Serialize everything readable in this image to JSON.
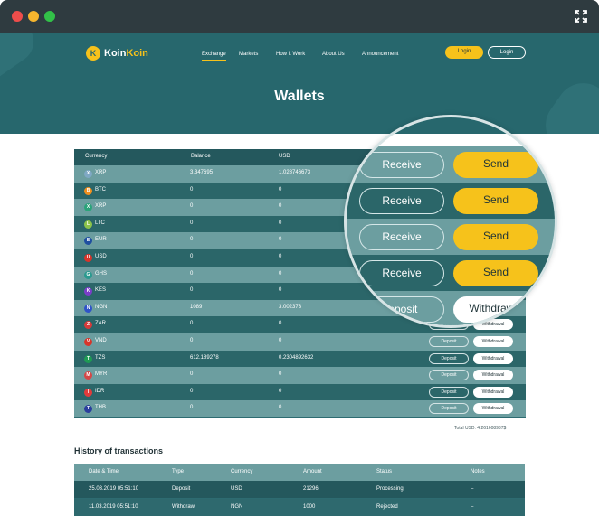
{
  "brand": {
    "coin_letter": "K",
    "name_part1": "Koin",
    "name_part2": "Koin"
  },
  "nav": [
    "Exchange",
    "Markets",
    "How it Work",
    "About Us",
    "Announcement"
  ],
  "auth": {
    "login_primary": "Login",
    "login_secondary": "Login"
  },
  "page_title": "Wallets",
  "wallet_headers": [
    "Currency",
    "Balance",
    "USD"
  ],
  "wallets": [
    {
      "code": "XRP",
      "balance": "3.347695",
      "usd": "1.028746673",
      "color": "#7fa8c4"
    },
    {
      "code": "BTC",
      "balance": "0",
      "usd": "0",
      "color": "#f18f1e"
    },
    {
      "code": "XRP",
      "balance": "0",
      "usd": "0",
      "color": "#2ba37a"
    },
    {
      "code": "LTC",
      "balance": "0",
      "usd": "0",
      "color": "#8cc34a"
    },
    {
      "code": "EUR",
      "balance": "0",
      "usd": "0",
      "color": "#1f4fa0"
    },
    {
      "code": "USD",
      "balance": "0",
      "usd": "0",
      "color": "#d8342a"
    },
    {
      "code": "GHS",
      "balance": "0",
      "usd": "0",
      "color": "#2b9a8f"
    },
    {
      "code": "KES",
      "balance": "0",
      "usd": "0",
      "color": "#7b3ec9"
    },
    {
      "code": "NGN",
      "balance": "1089",
      "usd": "3.002373",
      "color": "#2f53c8"
    },
    {
      "code": "ZAR",
      "balance": "0",
      "usd": "0",
      "color": "#d73b3b"
    },
    {
      "code": "VND",
      "balance": "0",
      "usd": "0",
      "color": "#d7352a"
    },
    {
      "code": "TZS",
      "balance": "612.189278",
      "usd": "0.2304892632",
      "color": "#1e9b54"
    },
    {
      "code": "MYR",
      "balance": "0",
      "usd": "0",
      "color": "#d54747"
    },
    {
      "code": "IDR",
      "balance": "0",
      "usd": "0",
      "color": "#e23b3b"
    },
    {
      "code": "THB",
      "balance": "0",
      "usd": "0",
      "color": "#2a3e9d"
    }
  ],
  "actions": {
    "deposit": "Deposit",
    "withdraw": "Withdrawal",
    "receive": "Receive",
    "send": "Send",
    "withdraw_zoom": "Withdrawal"
  },
  "total_usd": "Total USD: 4.261608937$",
  "history": {
    "title": "History of transactions",
    "headers": [
      "Date & Time",
      "Type",
      "Currency",
      "Amount",
      "Status",
      "Notes"
    ],
    "rows": [
      [
        "25.03.2019 05:51:10",
        "Deposit",
        "USD",
        "21296",
        "Processing",
        "–"
      ],
      [
        "11.03.2019 05:51:10",
        "Withdraw",
        "NGN",
        "1000",
        "Rejected",
        "–"
      ]
    ]
  }
}
